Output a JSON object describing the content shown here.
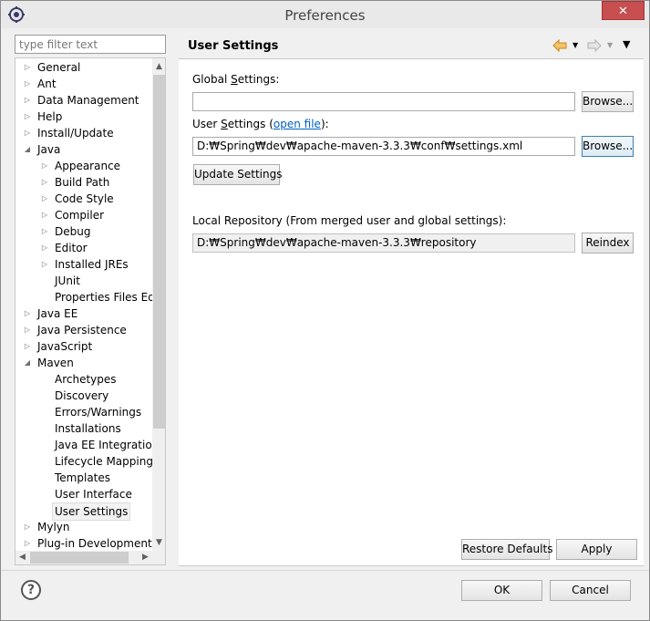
{
  "window": {
    "title": "Preferences",
    "close_label": "✕"
  },
  "filter": {
    "placeholder": "type filter text"
  },
  "tree": {
    "items": [
      {
        "label": "General",
        "level": 0,
        "arrow": "closed"
      },
      {
        "label": "Ant",
        "level": 0,
        "arrow": "closed"
      },
      {
        "label": "Data Management",
        "level": 0,
        "arrow": "closed"
      },
      {
        "label": "Help",
        "level": 0,
        "arrow": "closed"
      },
      {
        "label": "Install/Update",
        "level": 0,
        "arrow": "closed"
      },
      {
        "label": "Java",
        "level": 0,
        "arrow": "open"
      },
      {
        "label": "Appearance",
        "level": 1,
        "arrow": "closed"
      },
      {
        "label": "Build Path",
        "level": 1,
        "arrow": "closed"
      },
      {
        "label": "Code Style",
        "level": 1,
        "arrow": "closed"
      },
      {
        "label": "Compiler",
        "level": 1,
        "arrow": "closed"
      },
      {
        "label": "Debug",
        "level": 1,
        "arrow": "closed"
      },
      {
        "label": "Editor",
        "level": 1,
        "arrow": "closed"
      },
      {
        "label": "Installed JREs",
        "level": 1,
        "arrow": "closed"
      },
      {
        "label": "JUnit",
        "level": 1,
        "arrow": "none"
      },
      {
        "label": "Properties Files Editor",
        "level": 1,
        "arrow": "none"
      },
      {
        "label": "Java EE",
        "level": 0,
        "arrow": "closed"
      },
      {
        "label": "Java Persistence",
        "level": 0,
        "arrow": "closed"
      },
      {
        "label": "JavaScript",
        "level": 0,
        "arrow": "closed"
      },
      {
        "label": "Maven",
        "level": 0,
        "arrow": "open"
      },
      {
        "label": "Archetypes",
        "level": 1,
        "arrow": "none"
      },
      {
        "label": "Discovery",
        "level": 1,
        "arrow": "none"
      },
      {
        "label": "Errors/Warnings",
        "level": 1,
        "arrow": "none"
      },
      {
        "label": "Installations",
        "level": 1,
        "arrow": "none"
      },
      {
        "label": "Java EE Integration",
        "level": 1,
        "arrow": "none"
      },
      {
        "label": "Lifecycle Mappings",
        "level": 1,
        "arrow": "none"
      },
      {
        "label": "Templates",
        "level": 1,
        "arrow": "none"
      },
      {
        "label": "User Interface",
        "level": 1,
        "arrow": "none"
      },
      {
        "label": "User Settings",
        "level": 1,
        "arrow": "none",
        "selected": true
      },
      {
        "label": "Mylyn",
        "level": 0,
        "arrow": "closed"
      },
      {
        "label": "Plug-in Development",
        "level": 0,
        "arrow": "closed"
      }
    ]
  },
  "page": {
    "title": "User Settings",
    "global_settings": {
      "label_pre": "Global ",
      "label_u": "S",
      "label_post": "ettings:",
      "value": "",
      "browse_label": "Browse..."
    },
    "user_settings": {
      "label_pre": "User ",
      "label_u": "S",
      "label_post": "ettings (",
      "link": "open file",
      "label_end": "):",
      "value": "D:₩Spring₩dev₩apache-maven-3.3.3₩conf₩settings.xml",
      "browse_label": "Browse..."
    },
    "update_label": "Update Settings",
    "local_repo": {
      "label": "Local Repository (From merged user and global settings):",
      "value": "D:₩Spring₩dev₩apache-maven-3.3.3₩repository",
      "reindex_label": "Reindex"
    },
    "restore_label": "Restore Defaults",
    "apply_label": "Apply"
  },
  "dialog": {
    "ok_label": "OK",
    "cancel_label": "Cancel",
    "help_label": "?"
  },
  "colors": {
    "link": "#0060c0",
    "close": "#c74f50",
    "back_arrow": "#e8a33a",
    "forward_arrow": "#b8b8b8"
  }
}
